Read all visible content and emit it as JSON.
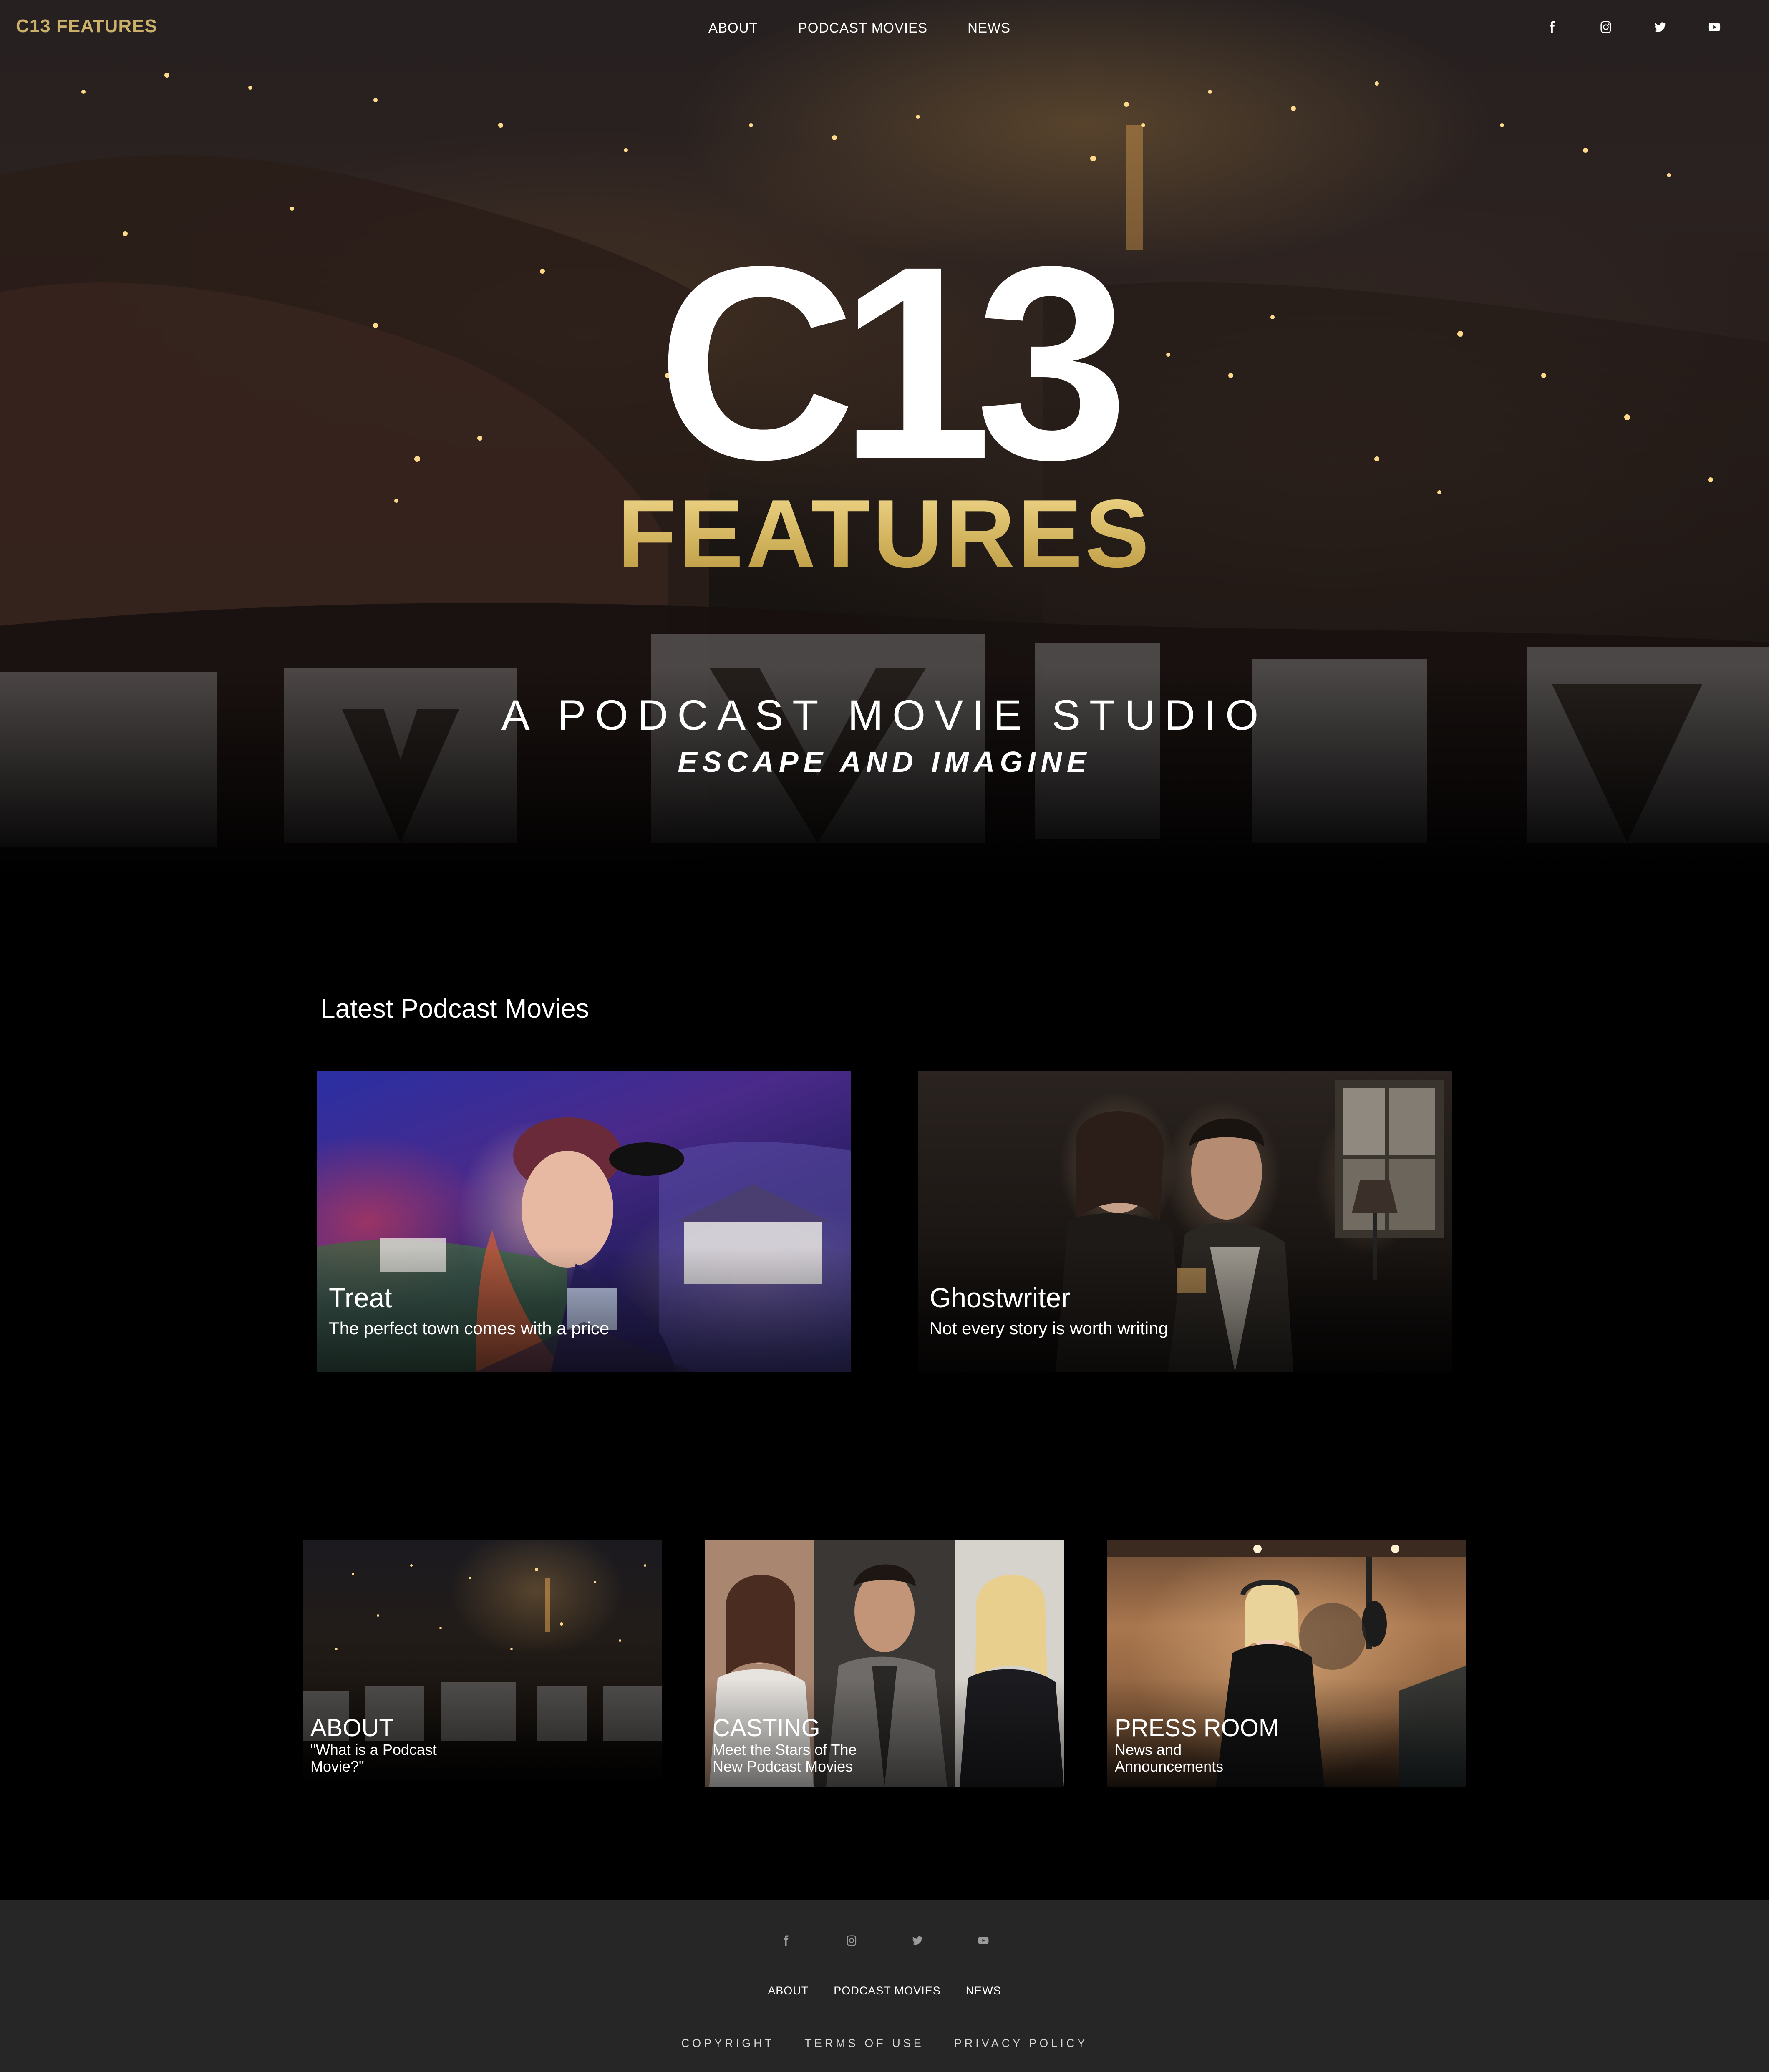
{
  "header": {
    "brand": "C13 FEATURES",
    "nav": [
      "ABOUT",
      "PODCAST MOVIES",
      "NEWS"
    ],
    "socials": [
      "facebook-icon",
      "instagram-icon",
      "twitter-icon",
      "youtube-icon"
    ]
  },
  "hero": {
    "logo_top": "C13",
    "logo_bottom": "FEATURES",
    "tagline": "A PODCAST MOVIE STUDIO",
    "subtagline": "ESCAPE AND IMAGINE"
  },
  "latest": {
    "title": "Latest Podcast Movies",
    "movies": [
      {
        "title": "Treat",
        "subtitle": "The perfect town comes with a price"
      },
      {
        "title": "Ghostwriter",
        "subtitle": "Not every story is worth writing"
      }
    ]
  },
  "tiles": [
    {
      "title": "ABOUT",
      "subtitle": "\"What is a Podcast Movie?\""
    },
    {
      "title": "CASTING",
      "subtitle": "Meet the Stars of The New Podcast Movies"
    },
    {
      "title": "PRESS ROOM",
      "subtitle": "News and Announcements"
    }
  ],
  "footer": {
    "nav": [
      "ABOUT",
      "PODCAST MOVIES",
      "NEWS"
    ],
    "legal": [
      "COPYRIGHT",
      "TERMS OF USE",
      "PRIVACY POLICY"
    ]
  },
  "colors": {
    "background": "#000000",
    "gold": "#d8bc6c",
    "footer_bg": "#262626"
  }
}
